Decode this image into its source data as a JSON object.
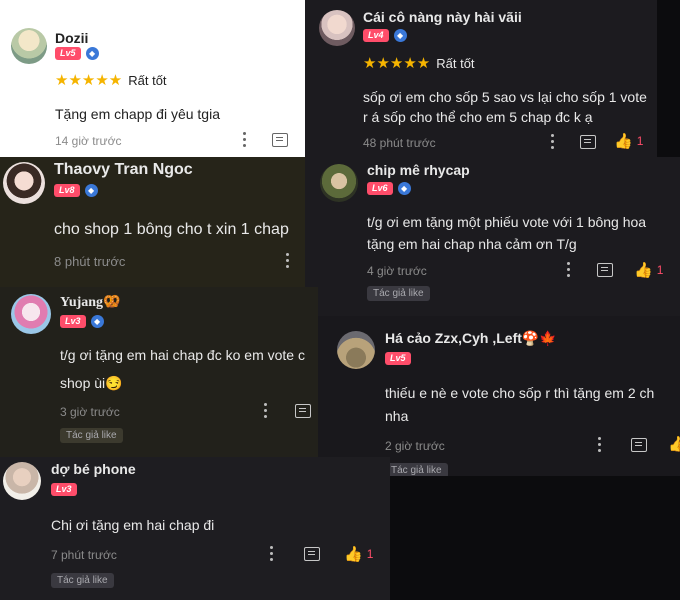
{
  "comments": [
    {
      "name": "Dozii",
      "level": "Lv5",
      "stars": "★★★★★",
      "rating": "Rất tốt",
      "text": "Tặng em chapp đi yêu tgia",
      "time": "14 giờ trước"
    },
    {
      "name": "Cái cô nàng này hài vãii",
      "level": "Lv4",
      "stars": "★★★★★",
      "rating": "Rất tốt",
      "line1": "sốp ơi em cho sốp 5 sao vs lại cho sốp 1 vote",
      "line2": "r á sốp cho thể cho em 5 chap đc k ạ",
      "time": "48 phút trước",
      "likes": "1"
    },
    {
      "name": "Thaovy Tran Ngoc",
      "level": "Lv8",
      "text": "cho shop 1 bông cho t xin 1 chap",
      "time": "8 phút trước"
    },
    {
      "name": "chip mê rhycap",
      "level": "Lv6",
      "line1": "t/g ơi em tặng một phiếu vote với 1 bông hoa",
      "line2": "tặng em hai chap nha cảm ơn T/g",
      "time": "4 giờ trước",
      "likes": "1",
      "tag": "Tác giả like"
    },
    {
      "name": "Yujang🥨",
      "level": "Lv3",
      "line1": "t/g ơi tặng em hai chap đc ko em vote c",
      "line2": "shop ùi😏",
      "time": "3 giờ trước",
      "tag": "Tác giả like"
    },
    {
      "name": "Há cảo Zzx,Cyh ,Left🍄🍁",
      "level": "Lv5",
      "line1": "thiếu e nè e vote cho sốp r thì tặng em 2 ch",
      "line2": "nha",
      "time": "2 giờ trước",
      "tag": "Tác giả like"
    },
    {
      "name": "dợ bé phone",
      "level": "Lv3",
      "text": "Chị ơi tặng em hai chap đi",
      "time": "7 phút trước",
      "likes": "1",
      "tag": "Tác giả like"
    }
  ],
  "icons": {
    "more": "more-vertical-icon",
    "reply": "reply-icon",
    "like": "thumbs-up-icon",
    "verified": "diamond-badge-icon"
  },
  "colors": {
    "level_badge": "#ff4d6a",
    "star": "#f5b400",
    "dark_bg": "#1c1b1f",
    "like": "#ff4d6a"
  }
}
